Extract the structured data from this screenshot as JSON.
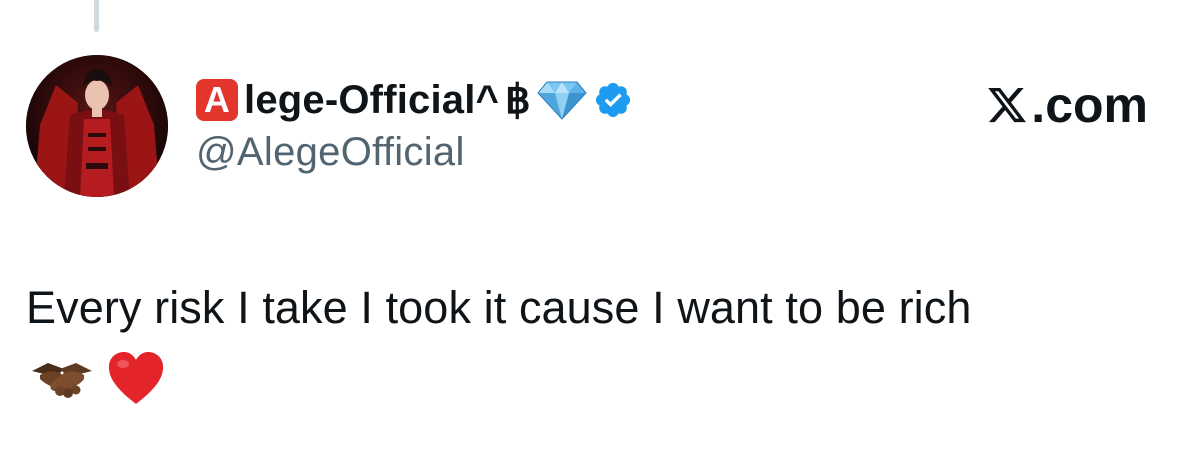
{
  "author": {
    "badge_letter": "A",
    "name_rest": "lege-Official^",
    "currency_symbol": "฿",
    "handle": "@AlegeOfficial",
    "avatar_icon": "avatar-image",
    "diamond_icon": "gem-icon",
    "verified_icon": "verified-badge-icon"
  },
  "brand": {
    "domain": ".com"
  },
  "tweet": {
    "text": "Every risk I take I took it cause I want to be rich",
    "emojis": [
      "handshake-icon",
      "red-heart-icon"
    ]
  },
  "colors": {
    "badge_red": "#e3352c",
    "verified_blue": "#1d9bf0",
    "handle_gray": "#536471",
    "text_dark": "#0f1419"
  }
}
